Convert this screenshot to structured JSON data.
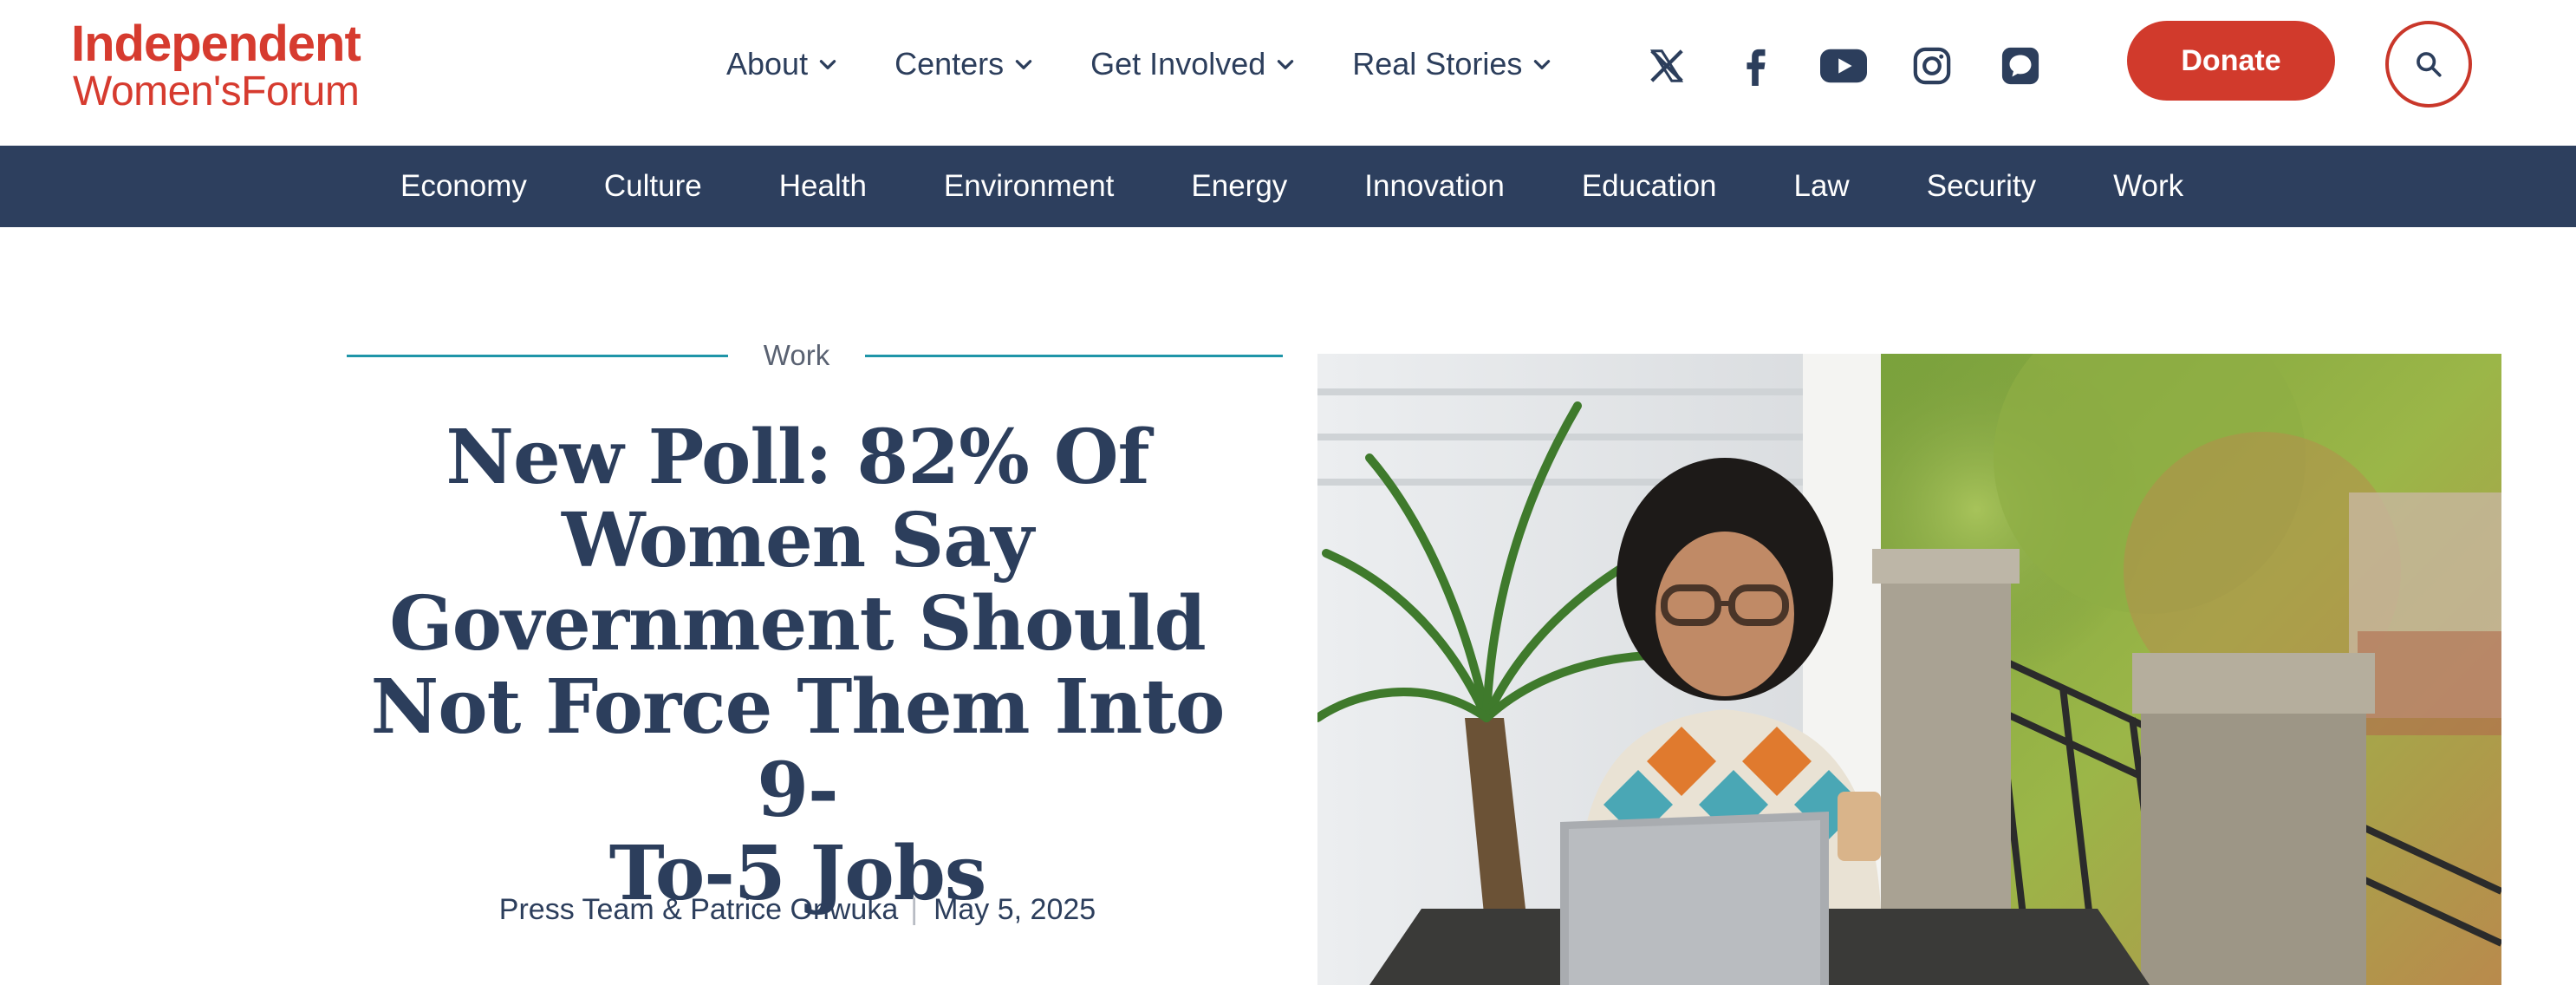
{
  "logo": {
    "line1": "Independent",
    "line2_a": "Women's",
    "line2_b": "Forum"
  },
  "main_nav": [
    {
      "label": "About"
    },
    {
      "label": "Centers"
    },
    {
      "label": "Get Involved"
    },
    {
      "label": "Real Stories"
    }
  ],
  "social": [
    "x-icon",
    "facebook-icon",
    "youtube-icon",
    "instagram-icon",
    "chat-icon"
  ],
  "donate_label": "Donate",
  "topics": [
    "Economy",
    "Culture",
    "Health",
    "Environment",
    "Energy",
    "Innovation",
    "Education",
    "Law",
    "Security",
    "Work"
  ],
  "article": {
    "category": "Work",
    "headline_lines": [
      "New Poll: 82% Of",
      "Women Say",
      "Government Should",
      "Not Force Them Into 9-",
      "To-5 Jobs"
    ],
    "authors": "Press Team & Patrice Onwuka",
    "separator": "|",
    "date": "May 5, 2025"
  },
  "colors": {
    "brand_red": "#d13a2c",
    "navy": "#2d3f5e",
    "teal": "#1f95a8",
    "text_navy": "#2c3e5c"
  }
}
